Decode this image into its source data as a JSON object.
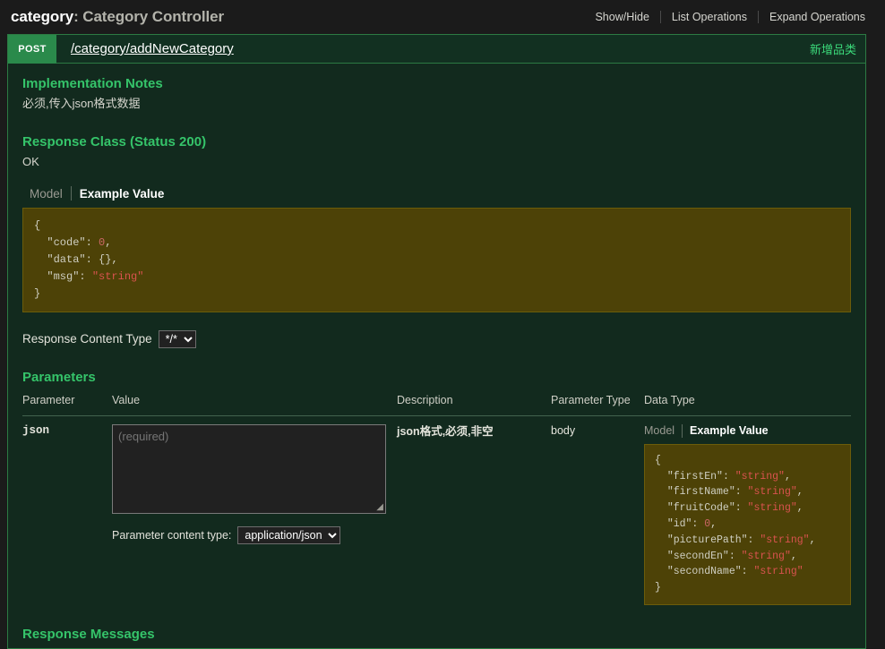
{
  "header": {
    "resource_name": "category",
    "resource_title": ": Category Controller",
    "links": [
      {
        "label": "Show/Hide"
      },
      {
        "label": "List Operations"
      },
      {
        "label": "Expand Operations"
      }
    ]
  },
  "operation": {
    "method": "POST",
    "path": "/category/addNewCategory",
    "summary": "新增品类"
  },
  "sections": {
    "implementation_notes_title": "Implementation Notes",
    "implementation_notes_body": "必须,传入json格式数据",
    "response_class_title": "Response Class (Status 200)",
    "response_class_body": "OK",
    "parameters_title": "Parameters",
    "response_messages_title": "Response Messages"
  },
  "model_tabs": {
    "model_label": "Model",
    "example_label": "Example Value"
  },
  "response_example": {
    "line_open": "{",
    "lines": [
      {
        "key": "\"code\"",
        "value": "0",
        "value_type": "num",
        "comma": ","
      },
      {
        "key": "\"data\"",
        "value": "{}",
        "value_type": "punc",
        "comma": ","
      },
      {
        "key": "\"msg\"",
        "value": "\"string\"",
        "value_type": "str",
        "comma": ""
      }
    ],
    "line_close": "}"
  },
  "response_content_type": {
    "label": "Response Content Type",
    "selected": "*/*",
    "options": [
      "*/*"
    ]
  },
  "parameters_table": {
    "columns": [
      {
        "label": "Parameter"
      },
      {
        "label": "Value"
      },
      {
        "label": "Description"
      },
      {
        "label": "Parameter Type"
      },
      {
        "label": "Data Type"
      }
    ],
    "rows": [
      {
        "parameter": "json",
        "value_placeholder": "(required)",
        "value_current": "",
        "description": "json格式,必须,非空",
        "parameter_type": "body",
        "content_type_label": "Parameter content type:",
        "content_type_selected": "application/json",
        "content_type_options": [
          "application/json"
        ]
      }
    ]
  },
  "model_example": {
    "line_open": "{",
    "lines": [
      {
        "key": "\"firstEn\"",
        "value": "\"string\"",
        "value_type": "str",
        "comma": ","
      },
      {
        "key": "\"firstName\"",
        "value": "\"string\"",
        "value_type": "str",
        "comma": ","
      },
      {
        "key": "\"fruitCode\"",
        "value": "\"string\"",
        "value_type": "str",
        "comma": ","
      },
      {
        "key": "\"id\"",
        "value": "0",
        "value_type": "num",
        "comma": ","
      },
      {
        "key": "\"picturePath\"",
        "value": "\"string\"",
        "value_type": "str",
        "comma": ","
      },
      {
        "key": "\"secondEn\"",
        "value": "\"string\"",
        "value_type": "str",
        "comma": ","
      },
      {
        "key": "\"secondName\"",
        "value": "\"string\"",
        "value_type": "str",
        "comma": ""
      }
    ],
    "line_close": "}"
  },
  "colors": {
    "page_bg": "#1b1b1b",
    "panel_bg": "#122a1e",
    "panel_border": "#2c7a43",
    "method_post": "#2a8a4b",
    "section_heading": "#35c46a",
    "summary_green": "#3bd97a",
    "code_bg": "#4d4207",
    "string_red": "#d9534f"
  }
}
